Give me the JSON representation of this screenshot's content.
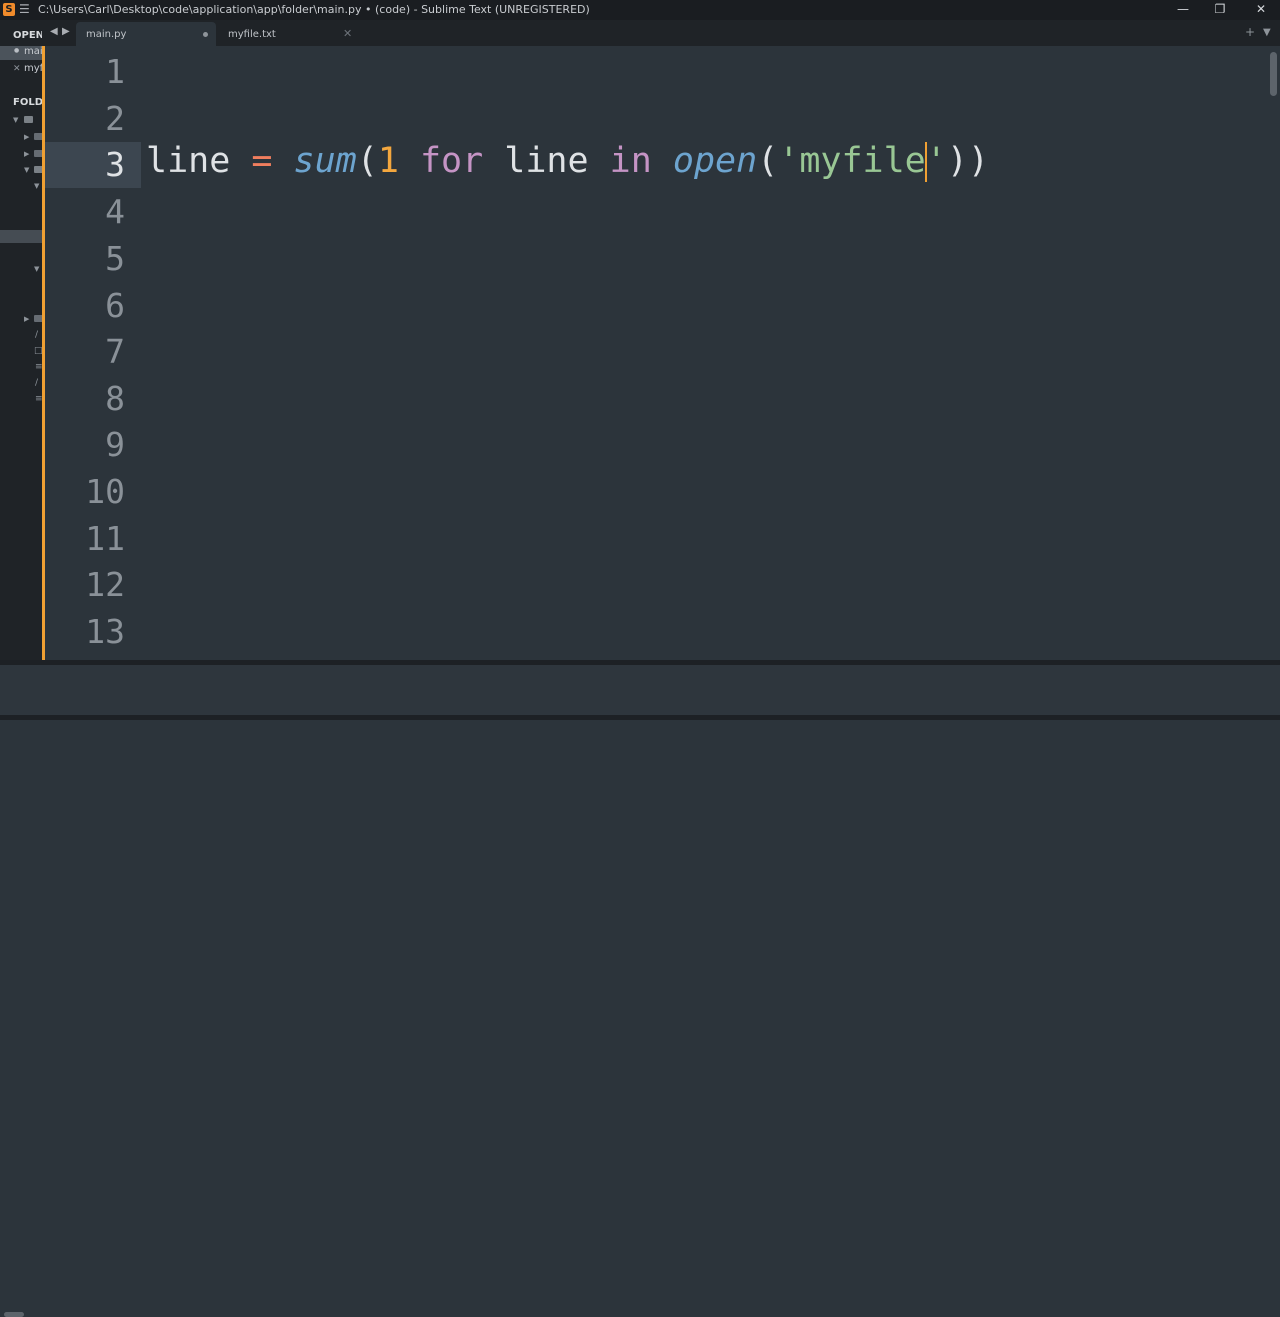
{
  "window": {
    "title": "C:\\Users\\Carl\\Desktop\\code\\application\\app\\folder\\main.py • (code) - Sublime Text (UNREGISTERED)",
    "app_icon": "S",
    "menu_icon": "☰",
    "minimize": "—",
    "maximize": "❐",
    "close": "✕"
  },
  "sidebar": {
    "open_files_header": "OPEN",
    "open_files": [
      {
        "name": "main",
        "marker": "●"
      },
      {
        "name": "myfi",
        "marker": "✕"
      }
    ],
    "folders_header": "FOLD"
  },
  "tabs": {
    "nav_left": "◀",
    "nav_right": "▶",
    "items": [
      {
        "label": "main.py",
        "active": true,
        "dirty": true
      },
      {
        "label": "myfile.txt",
        "active": false,
        "close": "✕"
      }
    ],
    "new_tab": "+",
    "menu": "▼"
  },
  "editor": {
    "current_line": 3,
    "line_numbers": [
      "1",
      "2",
      "3",
      "4",
      "5",
      "6",
      "7",
      "8",
      "9",
      "10",
      "11",
      "12",
      "13"
    ],
    "code_tokens": {
      "var": "line",
      "assign": " = ",
      "func1": "sum",
      "paren_open": "(",
      "number": "1",
      "kw_for": "for",
      "var2": "line",
      "kw_in": "in",
      "func2": "open",
      "paren_open2": "(",
      "string": "'myfile",
      "string_end": "'",
      "paren_close": "))"
    }
  },
  "colors": {
    "background": "#2c343b",
    "accent": "#f0a033",
    "keyword": "#c594c5",
    "function": "#6da4cf",
    "number": "#f4a73e",
    "string": "#99c794",
    "operator": "#f07e5e"
  }
}
